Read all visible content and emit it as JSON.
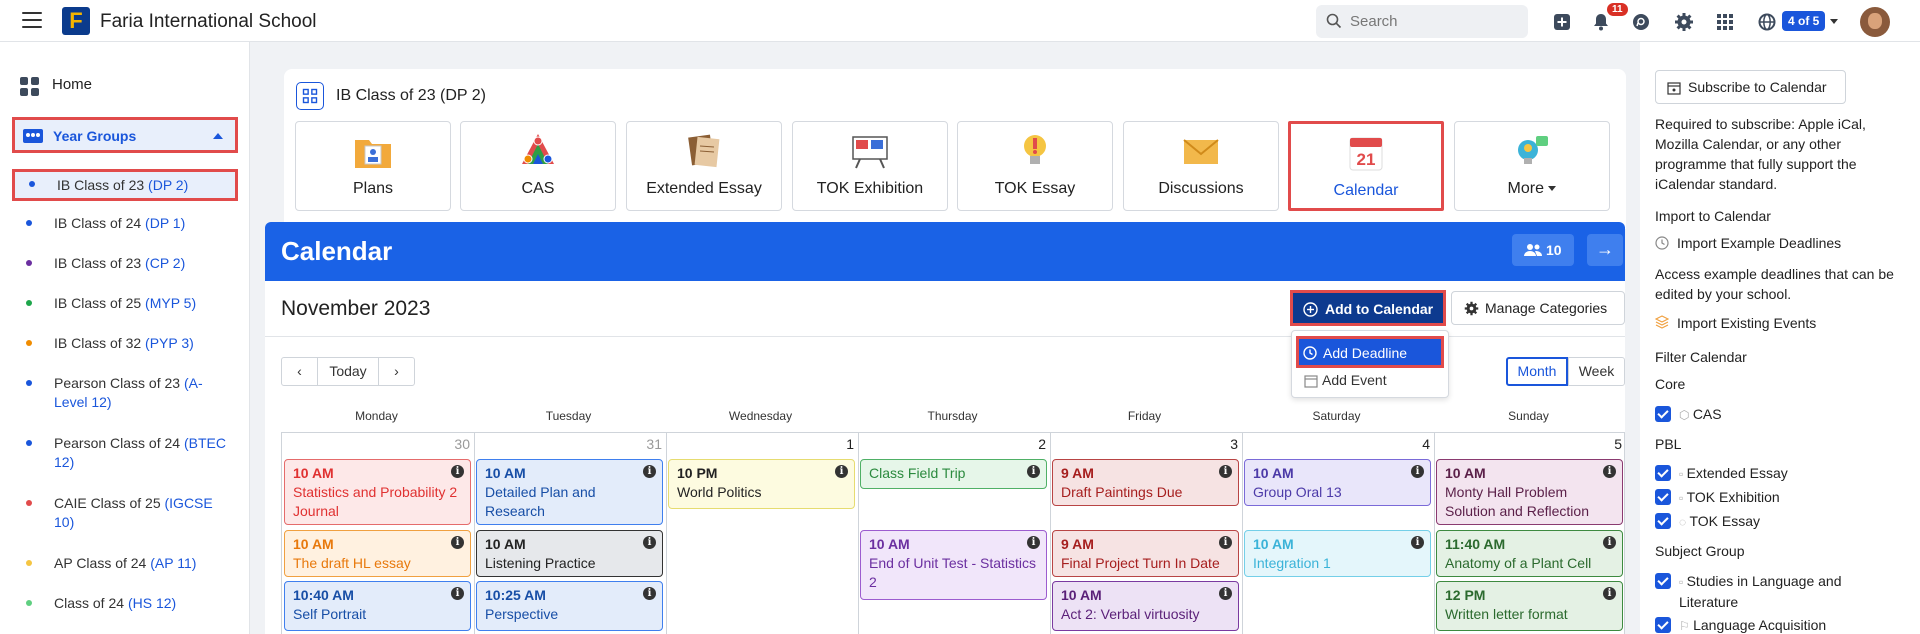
{
  "app": {
    "school_name": "Faria International School",
    "logo_letter": "F"
  },
  "search": {
    "placeholder": "Search"
  },
  "notifications": {
    "count": "11"
  },
  "account": {
    "switch_label": "4 of 5"
  },
  "sidebar": {
    "home": "Home",
    "year_groups": "Year Groups",
    "items": [
      {
        "name": "IB Class of 23 ",
        "sub": "(DP 2)",
        "color": "#1a56db"
      },
      {
        "name": "IB Class of 24 ",
        "sub": "(DP 1)",
        "color": "#1a56db"
      },
      {
        "name": "IB Class of 23 ",
        "sub": "(CP 2)",
        "color": "#6b2fa0"
      },
      {
        "name": "IB Class of 25 ",
        "sub": "(MYP 5)",
        "color": "#1ea64b"
      },
      {
        "name": "IB Class of 32 ",
        "sub": "(PYP 3)",
        "color": "#f08c00"
      },
      {
        "name": "Pearson Class of 23 ",
        "sub": "(A-Level 12)",
        "color": "#1a56db"
      },
      {
        "name": "Pearson Class of 24 ",
        "sub": "(BTEC 12)",
        "color": "#1a56db"
      },
      {
        "name": "CAIE Class of 25 ",
        "sub": "(IGCSE 10)",
        "color": "#e14b4b"
      },
      {
        "name": "AP Class of 24 ",
        "sub": "(AP 11)",
        "color": "#f5c542"
      },
      {
        "name": "Class of 24 ",
        "sub": "(HS 12)",
        "color": "#5fcf80"
      }
    ]
  },
  "class": {
    "title": "IB Class of 23 (DP 2)",
    "tiles": [
      "Plans",
      "CAS",
      "Extended Essay",
      "TOK Exhibition",
      "TOK Essay",
      "Discussions",
      "Calendar",
      "More"
    ]
  },
  "calendar": {
    "title": "Calendar",
    "members_count": "10",
    "month_label": "November 2023",
    "add_to_calendar": "Add to Calendar",
    "manage_categories": "Manage Categories",
    "dropdown": {
      "add_deadline": "Add Deadline",
      "add_event": "Add Event"
    },
    "today": "Today",
    "view_month": "Month",
    "view_week": "Week",
    "weekdays": [
      "Monday",
      "Tuesday",
      "Wednesday",
      "Thursday",
      "Friday",
      "Saturday",
      "Sunday"
    ],
    "day_numbers": [
      "30",
      "31",
      "1",
      "2",
      "3",
      "4",
      "5"
    ],
    "events": [
      {
        "col": 0,
        "row": 0,
        "time": "10 AM",
        "title": "Statistics and Probability 2 Journal",
        "text": "#e03131",
        "bg": "#fde8e8",
        "border": "#e56b6b"
      },
      {
        "col": 0,
        "row": 1,
        "time": "10 AM",
        "title": "The draft HL essay",
        "text": "#e8790c",
        "bg": "#fff1e0",
        "border": "#f0a040"
      },
      {
        "col": 0,
        "row": 2,
        "time": "10:40 AM",
        "title": "Self Portrait",
        "text": "#174ea6",
        "bg": "#e3ecfa",
        "border": "#3f7fee"
      },
      {
        "col": 1,
        "row": 0,
        "time": "10 AM",
        "title": "Detailed Plan and Research",
        "text": "#174ea6",
        "bg": "#e3ecfa",
        "border": "#3f7fee"
      },
      {
        "col": 1,
        "row": 1,
        "time": "10 AM",
        "title": "Listening Practice",
        "text": "#222222",
        "bg": "#e6e8eb",
        "border": "#333333"
      },
      {
        "col": 1,
        "row": 2,
        "time": "10:25 AM",
        "title": "Perspective",
        "text": "#174ea6",
        "bg": "#e3ecfa",
        "border": "#3f7fee"
      },
      {
        "col": 2,
        "row": 0,
        "time": "10 PM",
        "title": "World Politics",
        "text": "#222222",
        "bg": "#fdfbe0",
        "border": "#e6dc70"
      },
      {
        "col": 3,
        "row": 0,
        "time": "",
        "title": "Class Field Trip",
        "text": "#2b8a3e",
        "bg": "#e6f6e9",
        "border": "#4fb066"
      },
      {
        "col": 3,
        "row": 1,
        "time": "10 AM",
        "title": "End of Unit Test - Statistics 2",
        "text": "#6b2fa0",
        "bg": "#f1e6fa",
        "border": "#9c5ccf"
      },
      {
        "col": 4,
        "row": 0,
        "time": "9 AM",
        "title": "Draft Paintings Due",
        "text": "#a61e1e",
        "bg": "#f6e3e3",
        "border": "#b84444"
      },
      {
        "col": 4,
        "row": 1,
        "time": "9 AM",
        "title": "Final Project Turn In Date",
        "text": "#a61e1e",
        "bg": "#f6e3e3",
        "border": "#b84444"
      },
      {
        "col": 4,
        "row": 2,
        "time": "10 AM",
        "title": "Act 2: Verbal virtuosity",
        "text": "#5a1f78",
        "bg": "#ede2f5",
        "border": "#7a3aa0"
      },
      {
        "col": 5,
        "row": 0,
        "time": "10 AM",
        "title": "Group Oral 13",
        "text": "#4c3aa8",
        "bg": "#e9e6fa",
        "border": "#7a6ad8"
      },
      {
        "col": 5,
        "row": 1,
        "time": "10 AM",
        "title": "Integration 1",
        "text": "#3bb3d8",
        "bg": "#e4f6fb",
        "border": "#74cfe8"
      },
      {
        "col": 6,
        "row": 0,
        "time": "10 AM",
        "title": "Monty Hall Problem Solution and Reflection",
        "text": "#5a1f48",
        "bg": "#f3e4ef",
        "border": "#8a3a70"
      },
      {
        "col": 6,
        "row": 1,
        "time": "11:40 AM",
        "title": "Anatomy of a Plant Cell",
        "text": "#2b6a2e",
        "bg": "#e4f1e4",
        "border": "#3d8a40"
      },
      {
        "col": 6,
        "row": 2,
        "time": "12 PM",
        "title": "Written letter format",
        "text": "#2b6a2e",
        "bg": "#e4f1e4",
        "border": "#3d8a40"
      }
    ]
  },
  "right_panel": {
    "subscribe_button": "Subscribe to Calendar",
    "subscribe_note": "Required to subscribe: Apple iCal, Mozilla Calendar, or any other programme that fully support the iCalendar standard.",
    "import_heading": "Import to Calendar",
    "import_example": "Import Example Deadlines",
    "import_example_note": "Access example deadlines that can be edited by your school.",
    "import_existing": "Import Existing Events",
    "filter_heading": "Filter Calendar",
    "core_heading": "Core",
    "core_items": [
      "CAS"
    ],
    "pbl_heading": "PBL",
    "pbl_items": [
      "Extended Essay",
      "TOK Exhibition",
      "TOK Essay"
    ],
    "subject_heading": "Subject Group",
    "subject_items": [
      "Studies in Language and Literature",
      "Language Acquisition"
    ]
  }
}
